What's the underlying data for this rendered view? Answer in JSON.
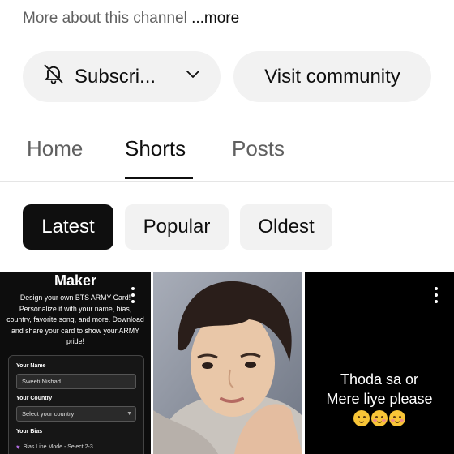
{
  "about": {
    "text": "More about this channel ",
    "more_label": "...more"
  },
  "actions": {
    "subscribe_label": "Subscri...",
    "visit_community_label": "Visit community"
  },
  "tabs": [
    {
      "label": "Home",
      "active": false
    },
    {
      "label": "Shorts",
      "active": true
    },
    {
      "label": "Posts",
      "active": false
    }
  ],
  "filters": [
    {
      "label": "Latest",
      "active": true
    },
    {
      "label": "Popular",
      "active": false
    },
    {
      "label": "Oldest",
      "active": false
    }
  ],
  "shorts": [
    {
      "heading": "Maker",
      "description": "Design your own BTS ARMY Card! Personalize it with your name, bias, country, favorite song, and more. Download and share your card to show your ARMY pride!",
      "form": {
        "name_label": "Your Name",
        "name_value": "Sweeti Nishad",
        "country_label": "Your Country",
        "country_placeholder": "Select your country",
        "bias_label": "Your Bias",
        "bias_option": "Bias Line Mode - Select 2-3"
      }
    },
    {
      "type": "photo"
    },
    {
      "text_line1": "Thoda sa or",
      "text_line2": "Mere liye please",
      "emoji_icons": [
        "pleading-face-icon",
        "smiling-face-with-hearts-icon",
        "kissing-face-icon"
      ]
    }
  ],
  "colors": {
    "text_primary": "#0f0f0f",
    "text_secondary": "#606060",
    "chip_bg": "#f2f2f2",
    "chip_active_bg": "#0f0f0f"
  }
}
